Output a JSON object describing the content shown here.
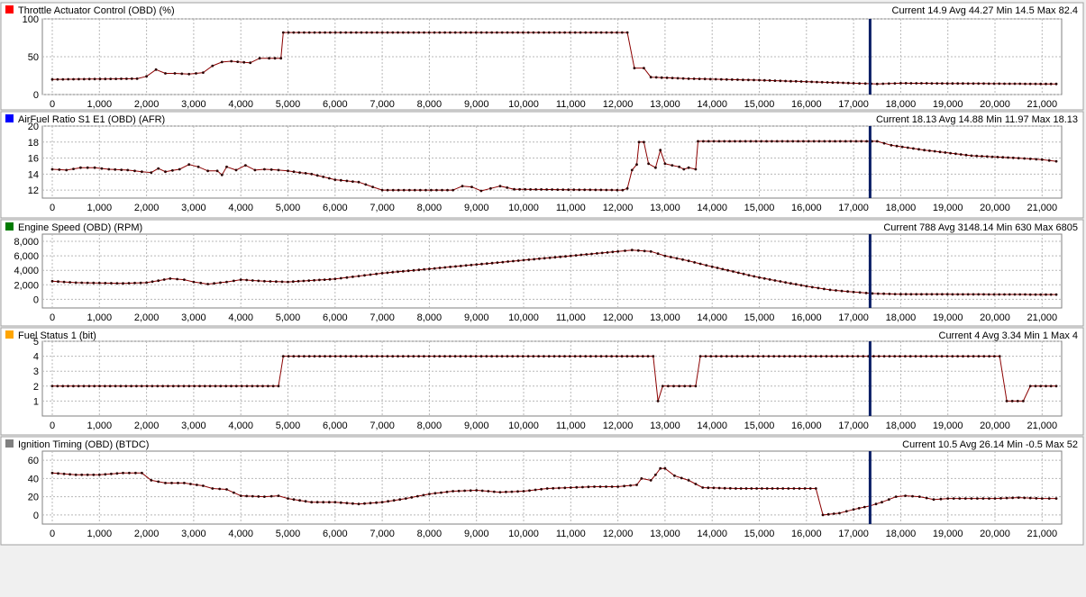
{
  "chart_data": [
    {
      "type": "line",
      "title": "Throttle Actuator Control (OBD) (%)",
      "stats": "Current 14.9 Avg 44.27 Min 14.5 Max 82.4",
      "series_color": "#ff0000",
      "line_color": "#8b0000",
      "ylim": [
        0,
        100
      ],
      "yticks": [
        0,
        50,
        100
      ],
      "ytick_labels": [
        "0",
        "50",
        "100"
      ],
      "xlim": [
        0,
        21300
      ],
      "xticks": [
        0,
        1000,
        2000,
        3000,
        4000,
        5000,
        6000,
        7000,
        8000,
        9000,
        10000,
        11000,
        12000,
        13000,
        14000,
        15000,
        16000,
        17000,
        18000,
        19000,
        20000,
        21000
      ],
      "xtick_labels": [
        "0",
        "1,000",
        "2,000",
        "3,000",
        "4,000",
        "5,000",
        "6,000",
        "7,000",
        "8,000",
        "9,000",
        "10,000",
        "11,000",
        "12,000",
        "13,000",
        "14,000",
        "15,000",
        "16,000",
        "17,000",
        "18,000",
        "19,000",
        "20,000",
        "21,000"
      ],
      "cursor_x": 17350,
      "grid": true,
      "points": [
        [
          0,
          20
        ],
        [
          1800,
          21
        ],
        [
          2000,
          24
        ],
        [
          2200,
          33
        ],
        [
          2400,
          28
        ],
        [
          2600,
          28
        ],
        [
          2900,
          27
        ],
        [
          3200,
          29
        ],
        [
          3400,
          38
        ],
        [
          3600,
          43
        ],
        [
          3800,
          44
        ],
        [
          4200,
          42
        ],
        [
          4400,
          48
        ],
        [
          4600,
          48
        ],
        [
          4850,
          48
        ],
        [
          4900,
          82
        ],
        [
          12200,
          82
        ],
        [
          12350,
          35
        ],
        [
          12550,
          35
        ],
        [
          12700,
          23
        ],
        [
          13500,
          21
        ],
        [
          15000,
          19
        ],
        [
          16000,
          17
        ],
        [
          17000,
          15
        ],
        [
          17500,
          14
        ],
        [
          18000,
          15
        ],
        [
          21300,
          14
        ]
      ]
    },
    {
      "type": "line",
      "title": "AirFuel Ratio S1 E1 (OBD) (AFR)",
      "stats": "Current 18.13 Avg 14.88 Min 11.97 Max 18.13",
      "series_color": "#0000ff",
      "line_color": "#8b0000",
      "ylim": [
        11,
        20
      ],
      "yticks": [
        12,
        14,
        16,
        18,
        20
      ],
      "ytick_labels": [
        "12",
        "14",
        "16",
        "18",
        "20"
      ],
      "xlim": [
        0,
        21300
      ],
      "xticks": [
        0,
        1000,
        2000,
        3000,
        4000,
        5000,
        6000,
        7000,
        8000,
        9000,
        10000,
        11000,
        12000,
        13000,
        14000,
        15000,
        16000,
        17000,
        18000,
        19000,
        20000,
        21000
      ],
      "xtick_labels": [
        "0",
        "1,000",
        "2,000",
        "3,000",
        "4,000",
        "5,000",
        "6,000",
        "7,000",
        "8,000",
        "9,000",
        "10,000",
        "11,000",
        "12,000",
        "13,000",
        "14,000",
        "15,000",
        "16,000",
        "17,000",
        "18,000",
        "19,000",
        "20,000",
        "21,000"
      ],
      "cursor_x": 17350,
      "grid": true,
      "points": [
        [
          0,
          14.6
        ],
        [
          300,
          14.5
        ],
        [
          600,
          14.8
        ],
        [
          900,
          14.8
        ],
        [
          1200,
          14.6
        ],
        [
          1600,
          14.5
        ],
        [
          1900,
          14.3
        ],
        [
          2100,
          14.2
        ],
        [
          2250,
          14.7
        ],
        [
          2400,
          14.3
        ],
        [
          2700,
          14.6
        ],
        [
          2900,
          15.2
        ],
        [
          3100,
          14.9
        ],
        [
          3300,
          14.4
        ],
        [
          3500,
          14.4
        ],
        [
          3600,
          13.9
        ],
        [
          3700,
          14.9
        ],
        [
          3900,
          14.5
        ],
        [
          4100,
          15.1
        ],
        [
          4300,
          14.5
        ],
        [
          4500,
          14.6
        ],
        [
          4800,
          14.5
        ],
        [
          5000,
          14.4
        ],
        [
          5500,
          14.0
        ],
        [
          6000,
          13.3
        ],
        [
          6500,
          13.0
        ],
        [
          6800,
          12.4
        ],
        [
          7000,
          12.0
        ],
        [
          8500,
          12.0
        ],
        [
          8700,
          12.5
        ],
        [
          8900,
          12.4
        ],
        [
          9100,
          11.9
        ],
        [
          9300,
          12.2
        ],
        [
          9500,
          12.5
        ],
        [
          9800,
          12.1
        ],
        [
          12100,
          12.0
        ],
        [
          12200,
          12.2
        ],
        [
          12300,
          14.5
        ],
        [
          12400,
          15.2
        ],
        [
          12450,
          18.0
        ],
        [
          12550,
          18.0
        ],
        [
          12650,
          15.3
        ],
        [
          12800,
          14.8
        ],
        [
          12900,
          17.0
        ],
        [
          13000,
          15.3
        ],
        [
          13300,
          14.9
        ],
        [
          13400,
          14.6
        ],
        [
          13500,
          14.8
        ],
        [
          13650,
          14.6
        ],
        [
          13700,
          18.1
        ],
        [
          17500,
          18.1
        ],
        [
          17800,
          17.6
        ],
        [
          18500,
          17.0
        ],
        [
          19500,
          16.3
        ],
        [
          20500,
          16.0
        ],
        [
          21000,
          15.8
        ],
        [
          21300,
          15.6
        ]
      ]
    },
    {
      "type": "line",
      "title": "Engine Speed (OBD) (RPM)",
      "stats": "Current 788 Avg 3148.14 Min 630 Max 6805",
      "series_color": "#007a00",
      "line_color": "#8b0000",
      "ylim": [
        -1200,
        9000
      ],
      "yticks": [
        0,
        2000,
        4000,
        6000,
        8000
      ],
      "ytick_labels": [
        "0",
        "2,000",
        "4,000",
        "6,000",
        "8,000"
      ],
      "xlim": [
        0,
        21300
      ],
      "xticks": [
        0,
        1000,
        2000,
        3000,
        4000,
        5000,
        6000,
        7000,
        8000,
        9000,
        10000,
        11000,
        12000,
        13000,
        14000,
        15000,
        16000,
        17000,
        18000,
        19000,
        20000,
        21000
      ],
      "xtick_labels": [
        "0",
        "1,000",
        "2,000",
        "3,000",
        "4,000",
        "5,000",
        "6,000",
        "7,000",
        "8,000",
        "9,000",
        "10,000",
        "11,000",
        "12,000",
        "13,000",
        "14,000",
        "15,000",
        "16,000",
        "17,000",
        "18,000",
        "19,000",
        "20,000",
        "21,000"
      ],
      "cursor_x": 17350,
      "grid": true,
      "points": [
        [
          0,
          2500
        ],
        [
          500,
          2300
        ],
        [
          1000,
          2250
        ],
        [
          1500,
          2200
        ],
        [
          2000,
          2300
        ],
        [
          2500,
          2850
        ],
        [
          2800,
          2700
        ],
        [
          3000,
          2400
        ],
        [
          3300,
          2100
        ],
        [
          3700,
          2400
        ],
        [
          4000,
          2700
        ],
        [
          4500,
          2500
        ],
        [
          5000,
          2400
        ],
        [
          6000,
          2800
        ],
        [
          6500,
          3200
        ],
        [
          7000,
          3600
        ],
        [
          8000,
          4200
        ],
        [
          9000,
          4800
        ],
        [
          10000,
          5400
        ],
        [
          11000,
          6000
        ],
        [
          12000,
          6600
        ],
        [
          12300,
          6800
        ],
        [
          12700,
          6600
        ],
        [
          13000,
          6000
        ],
        [
          13500,
          5300
        ],
        [
          14000,
          4500
        ],
        [
          15000,
          3000
        ],
        [
          16000,
          1800
        ],
        [
          16500,
          1300
        ],
        [
          17000,
          1000
        ],
        [
          17400,
          800
        ],
        [
          18000,
          700
        ],
        [
          21300,
          650
        ]
      ]
    },
    {
      "type": "line",
      "title": "Fuel Status 1 (bit)",
      "stats": "Current 4 Avg 3.34 Min 1 Max 4",
      "series_color": "#ffa500",
      "line_color": "#8b0000",
      "ylim": [
        0,
        5
      ],
      "yticks": [
        1,
        2,
        3,
        4,
        5
      ],
      "ytick_labels": [
        "1",
        "2",
        "3",
        "4",
        "5"
      ],
      "xlim": [
        0,
        21300
      ],
      "xticks": [
        0,
        1000,
        2000,
        3000,
        4000,
        5000,
        6000,
        7000,
        8000,
        9000,
        10000,
        11000,
        12000,
        13000,
        14000,
        15000,
        16000,
        17000,
        18000,
        19000,
        20000,
        21000
      ],
      "xtick_labels": [
        "0",
        "1,000",
        "2,000",
        "3,000",
        "4,000",
        "5,000",
        "6,000",
        "7,000",
        "8,000",
        "9,000",
        "10,000",
        "11,000",
        "12,000",
        "13,000",
        "14,000",
        "15,000",
        "16,000",
        "17,000",
        "18,000",
        "19,000",
        "20,000",
        "21,000"
      ],
      "cursor_x": 17350,
      "grid": true,
      "points": [
        [
          0,
          2
        ],
        [
          4800,
          2
        ],
        [
          4900,
          4
        ],
        [
          12750,
          4
        ],
        [
          12850,
          1
        ],
        [
          12950,
          2
        ],
        [
          13650,
          2
        ],
        [
          13750,
          4
        ],
        [
          20100,
          4
        ],
        [
          20250,
          1
        ],
        [
          20600,
          1
        ],
        [
          20750,
          2
        ],
        [
          21300,
          2
        ]
      ]
    },
    {
      "type": "line",
      "title": "Ignition Timing (OBD) (BTDC)",
      "stats": "Current 10.5 Avg 26.14 Min -0.5 Max 52",
      "series_color": "#808080",
      "line_color": "#8b0000",
      "ylim": [
        -10,
        70
      ],
      "yticks": [
        0,
        20,
        40,
        60
      ],
      "ytick_labels": [
        "0",
        "20",
        "40",
        "60"
      ],
      "xlim": [
        0,
        21300
      ],
      "xticks": [
        0,
        1000,
        2000,
        3000,
        4000,
        5000,
        6000,
        7000,
        8000,
        9000,
        10000,
        11000,
        12000,
        13000,
        14000,
        15000,
        16000,
        17000,
        18000,
        19000,
        20000,
        21000
      ],
      "xtick_labels": [
        "0",
        "1,000",
        "2,000",
        "3,000",
        "4,000",
        "5,000",
        "6,000",
        "7,000",
        "8,000",
        "9,000",
        "10,000",
        "11,000",
        "12,000",
        "13,000",
        "14,000",
        "15,000",
        "16,000",
        "17,000",
        "18,000",
        "19,000",
        "20,000",
        "21,000"
      ],
      "cursor_x": 17350,
      "grid": true,
      "points": [
        [
          0,
          46
        ],
        [
          500,
          44
        ],
        [
          1000,
          44
        ],
        [
          1500,
          46
        ],
        [
          1900,
          46
        ],
        [
          2100,
          38
        ],
        [
          2400,
          35
        ],
        [
          2800,
          35
        ],
        [
          3200,
          32
        ],
        [
          3400,
          29
        ],
        [
          3700,
          28
        ],
        [
          4000,
          21
        ],
        [
          4500,
          20
        ],
        [
          4800,
          21
        ],
        [
          5000,
          18
        ],
        [
          5500,
          14
        ],
        [
          6000,
          14
        ],
        [
          6500,
          12
        ],
        [
          7000,
          14
        ],
        [
          7500,
          18
        ],
        [
          8000,
          23
        ],
        [
          8500,
          26
        ],
        [
          9000,
          27
        ],
        [
          9500,
          25
        ],
        [
          10000,
          26
        ],
        [
          10500,
          29
        ],
        [
          11000,
          30
        ],
        [
          11500,
          31
        ],
        [
          12000,
          31
        ],
        [
          12400,
          33
        ],
        [
          12500,
          40
        ],
        [
          12700,
          38
        ],
        [
          12800,
          44
        ],
        [
          12900,
          51
        ],
        [
          13000,
          51
        ],
        [
          13200,
          43
        ],
        [
          13500,
          38
        ],
        [
          13800,
          30
        ],
        [
          14500,
          29
        ],
        [
          15500,
          29
        ],
        [
          16200,
          29
        ],
        [
          16350,
          0
        ],
        [
          16700,
          2
        ],
        [
          17000,
          6
        ],
        [
          17350,
          10
        ],
        [
          17600,
          14
        ],
        [
          17900,
          20
        ],
        [
          18100,
          21
        ],
        [
          18400,
          20
        ],
        [
          18700,
          17
        ],
        [
          19000,
          18
        ],
        [
          19500,
          18
        ],
        [
          20000,
          18
        ],
        [
          20500,
          19
        ],
        [
          21000,
          18
        ],
        [
          21300,
          18
        ]
      ]
    }
  ]
}
